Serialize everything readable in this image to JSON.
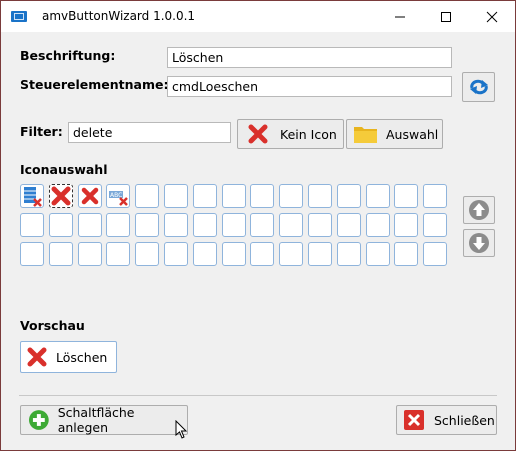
{
  "window": {
    "title": "amvButtonWizard 1.0.0.1",
    "minimize": "—",
    "maximize": "☐",
    "close": "✕"
  },
  "form": {
    "caption_label": "Beschriftung:",
    "caption_value": "Löschen",
    "control_label": "Steuerelementname:",
    "control_value": "cmdLoeschen",
    "filter_label": "Filter:",
    "filter_value": "delete",
    "no_icon_label": "Kein Icon",
    "select_label": "Auswahl"
  },
  "icon_selection": {
    "label": "Iconauswahl",
    "rows": 3,
    "cols": 15,
    "icons": [
      "table-delete-icon",
      "red-x-icon",
      "red-x-small-icon",
      "text-delete-icon"
    ]
  },
  "preview": {
    "label": "Vorschau",
    "button_label": "Löschen"
  },
  "footer": {
    "create_label": "Schaltfläche anlegen",
    "close_label": "Schließen"
  },
  "colors": {
    "accent_blue": "#1a73c8",
    "red_x": "#d9302b",
    "green_plus": "#3daa35",
    "window_border": "#7a3b3b"
  }
}
